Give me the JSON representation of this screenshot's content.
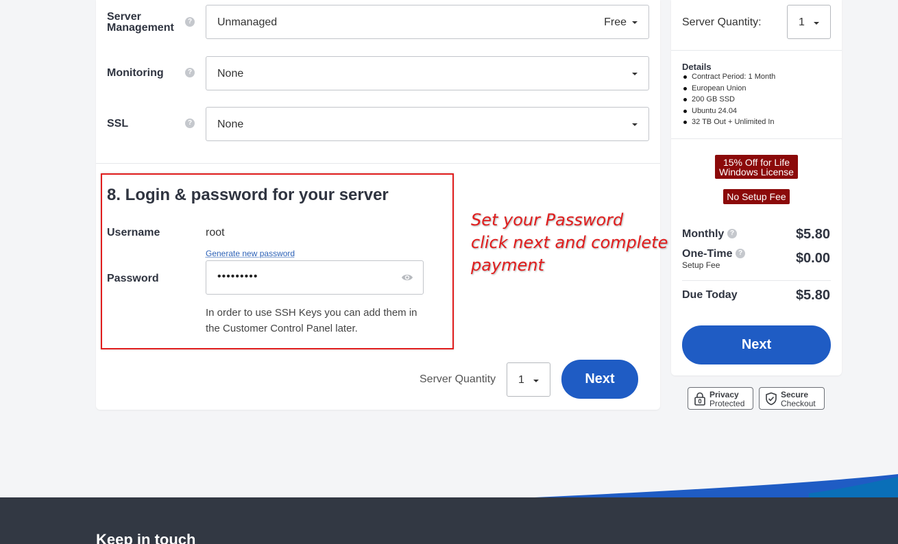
{
  "form": {
    "rows": [
      {
        "label": "Server Management",
        "value": "Unmanaged",
        "price": "Free"
      },
      {
        "label": "Monitoring",
        "value": "None",
        "price": ""
      },
      {
        "label": "SSL",
        "value": "None",
        "price": ""
      }
    ],
    "help_glyph": "?"
  },
  "login_section": {
    "title": "8. Login & password for your server",
    "username_label": "Username",
    "username_value": "root",
    "generate_link": "Generate new password",
    "password_label": "Password",
    "password_masked": "•••••••••",
    "ssh_note": "In order to use SSH Keys you can add them in the Customer Control Panel later."
  },
  "annotation": {
    "line1": "Set your Password",
    "line2": "click next and complete",
    "line3": "payment"
  },
  "bottom_bar": {
    "quantity_label": "Server Quantity",
    "quantity_value": "1",
    "next_label": "Next"
  },
  "sidebar": {
    "quantity_label": "Server Quantity:",
    "quantity_value": "1",
    "details_title": "Details",
    "details": [
      "Contract Period: 1 Month",
      "European Union",
      "200 GB SSD",
      "Ubuntu 24.04",
      "32 TB Out + Unlimited In"
    ],
    "promo_line1": "15% Off for Life",
    "promo_line2": "Windows License",
    "promo_setup": "No Setup Fee",
    "monthly_label": "Monthly",
    "monthly_amount": "$5.80",
    "onetime_label": "One-Time",
    "onetime_sub": "Setup Fee",
    "onetime_amount": "$0.00",
    "due_label": "Due Today",
    "due_amount": "$5.80",
    "next_label": "Next"
  },
  "badges": {
    "privacy_t1": "Privacy",
    "privacy_t2": "Protected",
    "secure_t1": "Secure",
    "secure_t2": "Checkout"
  },
  "footer": {
    "title": "Keep in touch"
  },
  "colors": {
    "primary": "#1f5cc4",
    "promo": "#8b0a0a",
    "annotation": "#e11d1d",
    "footer": "#323843"
  }
}
